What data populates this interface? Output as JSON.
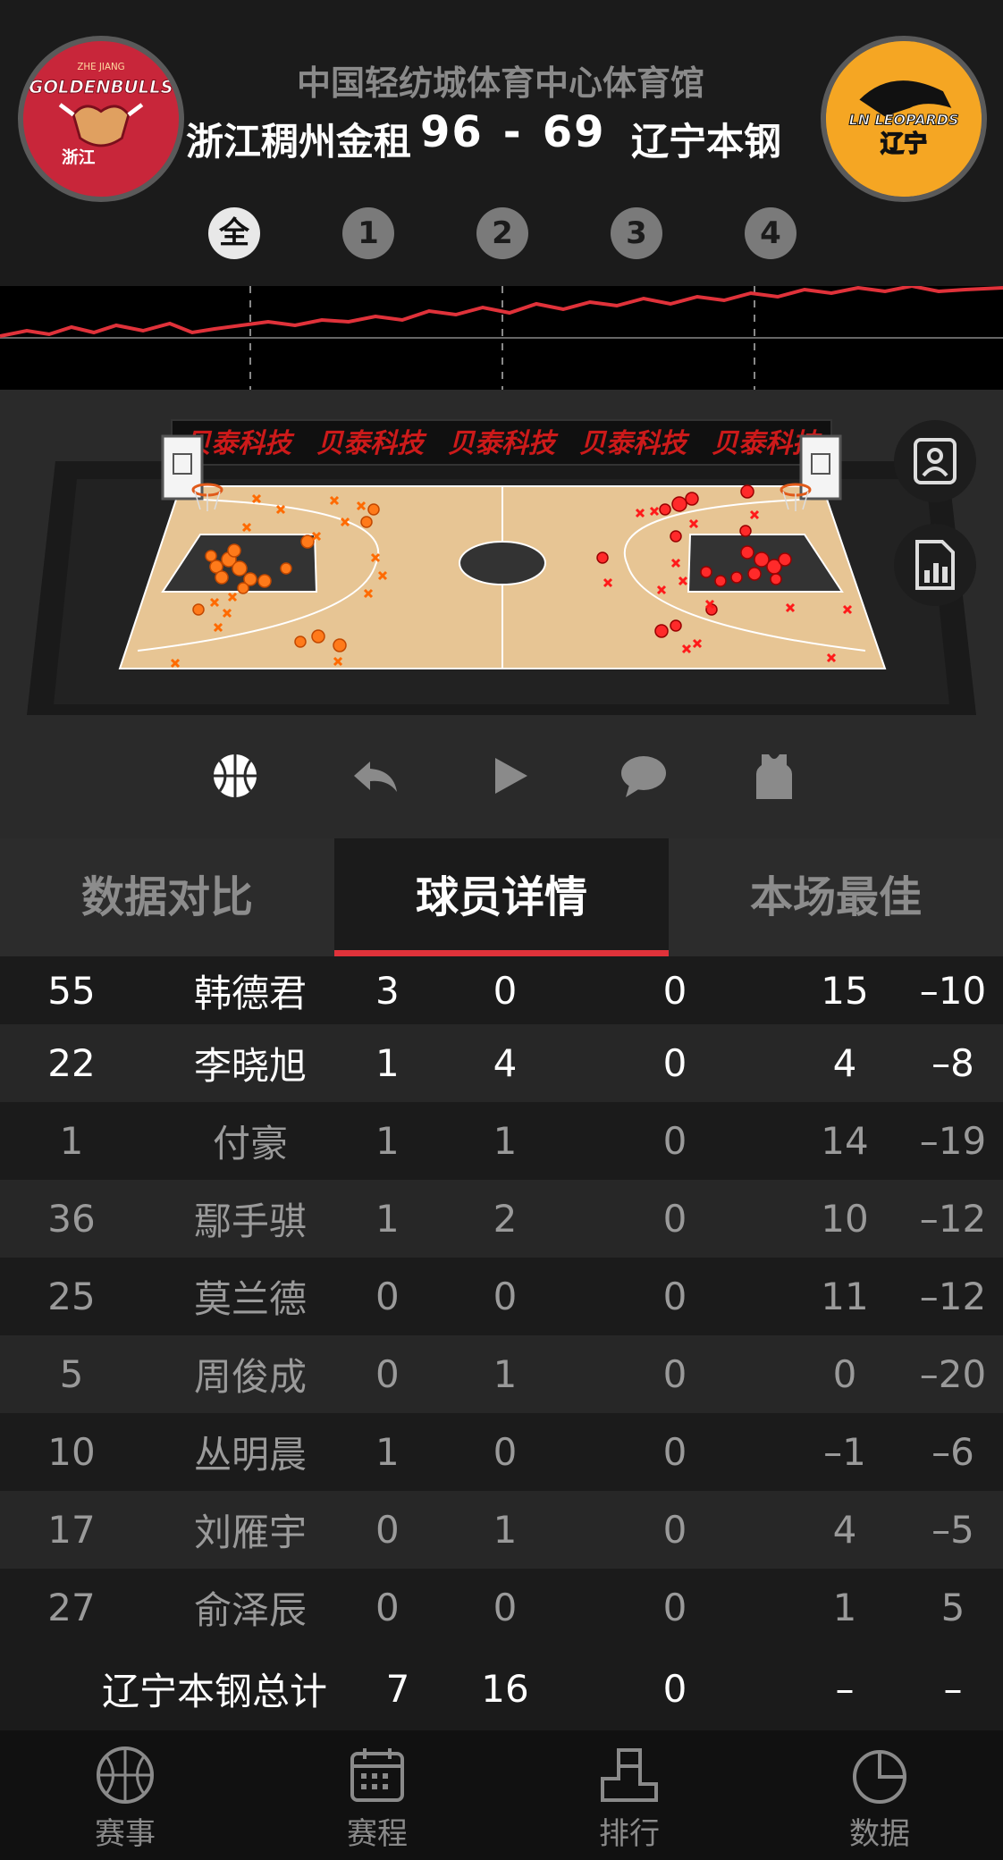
{
  "header": {
    "venue": "中国轻纺城体育中心体育馆",
    "home_team": "浙江稠州金租",
    "away_team": "辽宁本钢",
    "home_score": "96",
    "separator": "-",
    "away_score": "69",
    "home_logo_text": "GOLDENBULLS",
    "home_logo_sub": "浙江",
    "home_logo_top": "ZHE JIANG",
    "away_logo_text": "LN LEOPARDS",
    "away_logo_sub": "辽宁"
  },
  "quarters": {
    "items": [
      "全",
      "1",
      "2",
      "3",
      "4"
    ],
    "active_index": 0
  },
  "court": {
    "sponsor_banners": [
      "贝泰科技",
      "贝泰科技",
      "贝泰科技",
      "贝泰科技",
      "贝泰科技"
    ],
    "side_buttons": [
      "player-card-icon",
      "stats-report-icon"
    ]
  },
  "controls": {
    "icons": [
      "basketball-icon",
      "rewind-icon",
      "play-icon",
      "comment-icon",
      "jersey-icon"
    ]
  },
  "tabs": {
    "items": [
      "数据对比",
      "球员详情",
      "本场最佳"
    ],
    "active_index": 1
  },
  "table": {
    "rows": [
      {
        "num": "55",
        "name": "韩德君",
        "a": "3",
        "b": "0",
        "c": "0",
        "d": "15",
        "e": "–10",
        "style": "hi"
      },
      {
        "num": "22",
        "name": "李晓旭",
        "a": "1",
        "b": "4",
        "c": "0",
        "d": "4",
        "e": "–8",
        "style": "hi"
      },
      {
        "num": "1",
        "name": "付豪",
        "a": "1",
        "b": "1",
        "c": "0",
        "d": "14",
        "e": "–19",
        "style": "dim"
      },
      {
        "num": "36",
        "name": "鄢手骐",
        "a": "1",
        "b": "2",
        "c": "0",
        "d": "10",
        "e": "–12",
        "style": "dim"
      },
      {
        "num": "25",
        "name": "莫兰德",
        "a": "0",
        "b": "0",
        "c": "0",
        "d": "11",
        "e": "–12",
        "style": "dim"
      },
      {
        "num": "5",
        "name": "周俊成",
        "a": "0",
        "b": "1",
        "c": "0",
        "d": "0",
        "e": "–20",
        "style": "dim"
      },
      {
        "num": "10",
        "name": "丛明晨",
        "a": "1",
        "b": "0",
        "c": "0",
        "d": "–1",
        "e": "–6",
        "style": "dim"
      },
      {
        "num": "17",
        "name": "刘雁宇",
        "a": "0",
        "b": "1",
        "c": "0",
        "d": "4",
        "e": "–5",
        "style": "dim"
      },
      {
        "num": "27",
        "name": "俞泽辰",
        "a": "0",
        "b": "0",
        "c": "0",
        "d": "1",
        "e": "5",
        "style": "dim"
      }
    ],
    "total": {
      "name": "辽宁本钢总计",
      "a": "7",
      "b": "16",
      "c": "0",
      "d": "–",
      "e": "–"
    }
  },
  "bottom_nav": {
    "items": [
      {
        "label": "赛事",
        "icon": "basketball-icon"
      },
      {
        "label": "赛程",
        "icon": "calendar-icon"
      },
      {
        "label": "排行",
        "icon": "podium-icon"
      },
      {
        "label": "数据",
        "icon": "pie-chart-icon"
      }
    ]
  },
  "colors": {
    "accent": "#e0323a",
    "home_brand": "#c8263a",
    "away_brand": "#f5a623",
    "home_shots": "#ff6a00",
    "away_shots": "#ff1a1a"
  }
}
